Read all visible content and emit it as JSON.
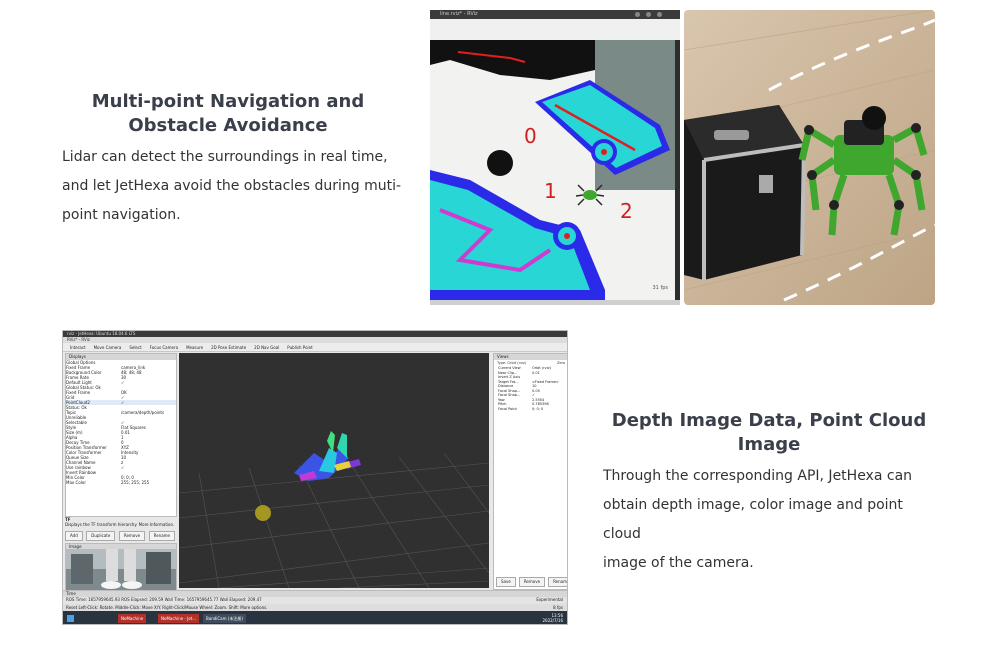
{
  "section_nav": {
    "title_line1": "Multi-point Navigation and",
    "title_line2": "Obstacle Avoidance",
    "desc_line1": "Lidar can detect the surroundings in real time,",
    "desc_line2": "and let JetHexa avoid the obstacles during muti-",
    "desc_line3": "point navigation."
  },
  "section_depth": {
    "title_line1": "Depth Image Data, Point Cloud",
    "title_line2": "Image",
    "desc_line1": "Through the corresponding API, JetHexa can",
    "desc_line2": "obtain depth image, color image and point cloud",
    "desc_line3": "image of the camera."
  },
  "nav_screenshot": {
    "window_title": "line.rviz* - RViz",
    "waypoint_labels": [
      "0",
      "1",
      "2"
    ],
    "fps": "31 fps",
    "colors": {
      "map_bg": "#f2f2f0",
      "obstacle_cyan": "#29d6d6",
      "inflation_blue": "#2a2ae8",
      "path_red": "#e02020",
      "unknown_gray": "#7a8a86"
    }
  },
  "robot_photo": {
    "colors": {
      "floor": "#c9b49b",
      "case": "#1a1a1a",
      "robot_green": "#3fa62e"
    }
  },
  "rviz_pointcloud": {
    "window_title": "rviz - JetHexa: Ubuntu 18.04.6 LTS",
    "menu": "RViz* - RViz",
    "toolbar": [
      "Interact",
      "Move Camera",
      "Select",
      "Focus Camera",
      "Measure",
      "2D Pose Estimate",
      "2D Nav Goal",
      "Publish Point"
    ],
    "displays_header": "Displays",
    "display_rows": [
      [
        "Global Options",
        ""
      ],
      [
        "Fixed Frame",
        "camera_link"
      ],
      [
        "Background Color",
        "48; 48; 48"
      ],
      [
        "Frame Rate",
        "30"
      ],
      [
        "Default Light",
        "✓"
      ],
      [
        "Global Status: Ok",
        ""
      ],
      [
        "Fixed Frame",
        "OK"
      ],
      [
        "Grid",
        "✓"
      ],
      [
        "PointCloud2",
        "✓"
      ],
      [
        "Status: Ok",
        ""
      ],
      [
        "Topic",
        "/camera/depth/points"
      ],
      [
        "Unreliable",
        ""
      ],
      [
        "Selectable",
        "✓"
      ],
      [
        "Style",
        "Flat Squares"
      ],
      [
        "Size (m)",
        "0.01"
      ],
      [
        "Alpha",
        "1"
      ],
      [
        "Decay Time",
        "0"
      ],
      [
        "Position Transformer",
        "XYZ"
      ],
      [
        "Color Transformer",
        "Intensity"
      ],
      [
        "Queue Size",
        "10"
      ],
      [
        "Channel Name",
        "z"
      ],
      [
        "Use rainbow",
        "✓"
      ],
      [
        "Invert Rainbow",
        ""
      ],
      [
        "Min Color",
        "0; 0; 0"
      ],
      [
        "Max Color",
        "255; 255; 255"
      ]
    ],
    "tf_label": "TF",
    "tf_desc": "Displays the TF transform hierarchy. More Information.",
    "display_buttons": [
      "Add",
      "Duplicate",
      "Remove",
      "Rename"
    ],
    "image_header": "Image",
    "views_header": "Views",
    "views_type": "Type:  Orbit (rviz)",
    "views_zero": "Zero",
    "views_rows": [
      [
        "Current View",
        "Orbit (rviz)"
      ],
      [
        "Near Clip...",
        "0.01"
      ],
      [
        "Invert Z Axis",
        ""
      ],
      [
        "Target Fra...",
        "<Fixed Frame>"
      ],
      [
        "Distance",
        "10"
      ],
      [
        "Focal Shap...",
        "0.05"
      ],
      [
        "Focal Shap...",
        "✓"
      ],
      [
        "Yaw",
        "2.5554"
      ],
      [
        "Pitch",
        "0.785398"
      ],
      [
        "Focal Point",
        "0; 0; 0"
      ]
    ],
    "views_buttons": [
      "Save",
      "Remove",
      "Rename"
    ],
    "time_header": "Time",
    "time_row": "ROS Time: 1657959645.93     ROS Elapsed: 209.59     Wall Time: 1657959645.77     Wall Elapsed: 209.47",
    "time_mode": "Experimental",
    "status_row": "Reset    Left-Click: Rotate. Middle-Click: Move X/Y. Right-Click/Mouse Wheel: Zoom. Shift: More options.",
    "status_fps": "8 fps",
    "taskbar_items": [
      "NoMachine",
      "NoMachine - Jet...",
      "BandiCam (未注册)"
    ],
    "clock_time": "13:56",
    "clock_date": "2022/7/16"
  }
}
